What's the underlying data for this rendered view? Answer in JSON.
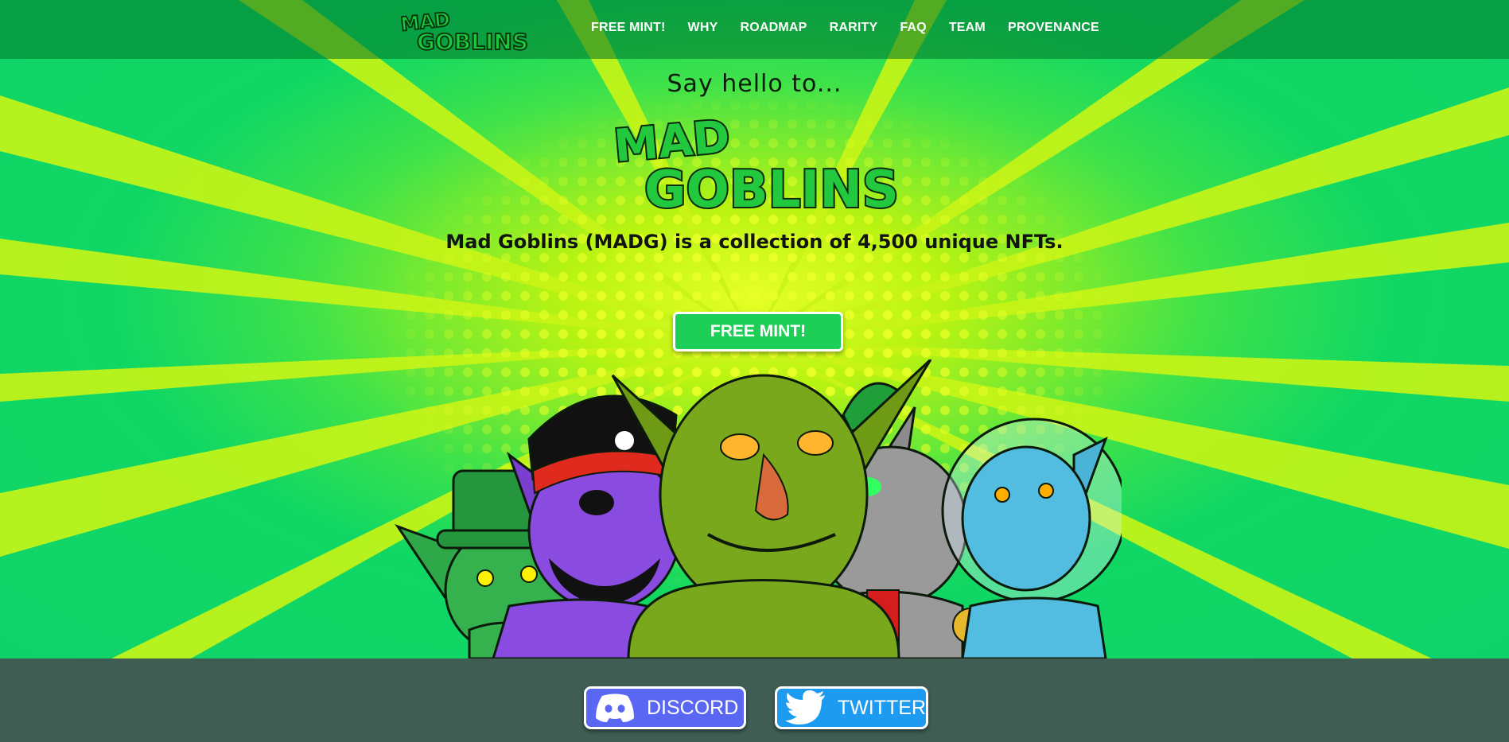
{
  "nav": {
    "logo_text": "Mad Goblins",
    "links": [
      "FREE MINT!",
      "WHY",
      "ROADMAP",
      "RARITY",
      "FAQ",
      "TEAM",
      "PROVENANCE"
    ]
  },
  "hero": {
    "greeting": "Say hello to...",
    "logo_text": "Mad Goblins",
    "tagline": "Mad Goblins (MADG) is a collection of 4,500 unique NFTs.",
    "mint_button": "FREE MINT!"
  },
  "social": {
    "discord_label": "DISCORD",
    "twitter_label": "TWITTER"
  },
  "colors": {
    "nav_bg": "#0a7a2f",
    "mint_button": "#1ecf57",
    "footer_bg": "#3f5d52",
    "discord": "#5967f2",
    "twitter": "#1d9bf0"
  }
}
